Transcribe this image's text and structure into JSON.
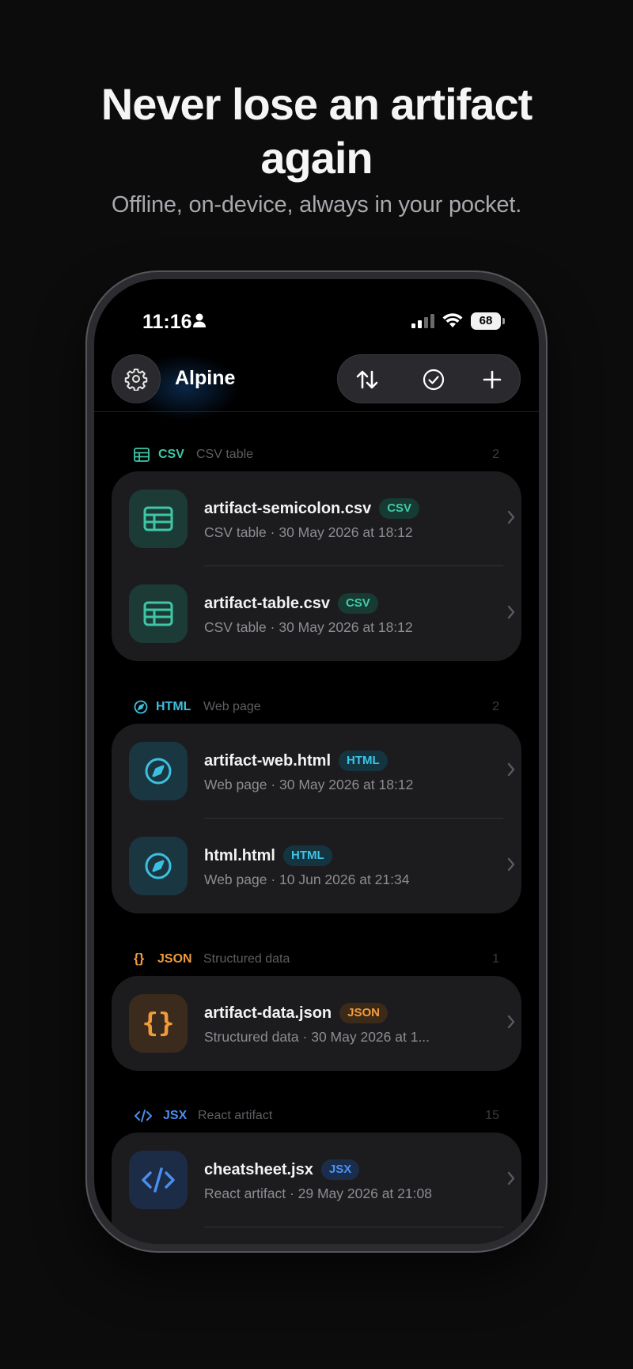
{
  "hero": {
    "title_line1": "Never lose an artifact",
    "title_line2": "again",
    "subtitle": "Offline, on-device, always in your pocket."
  },
  "status_bar": {
    "time": "11:16",
    "battery": "68",
    "icons": [
      "person-icon",
      "signal-icon",
      "wifi-icon",
      "battery-icon"
    ]
  },
  "nav": {
    "app_name": "Alpine",
    "icons": [
      "gear-icon",
      "sort-icon",
      "select-check-icon",
      "plus-icon"
    ]
  },
  "colors": {
    "csv": "#3fc6a7",
    "html": "#3cbfe0",
    "json": "#f09a3c",
    "jsx": "#4a8fef",
    "background": "#0c0c0d",
    "card": "#1c1c1f"
  },
  "sections": [
    {
      "type": "CSV",
      "description": "CSV table",
      "count": "2",
      "icon": "table-icon",
      "items": [
        {
          "title": "artifact-semicolon.csv",
          "badge": "CSV",
          "subtitle": "CSV table · 30 May 2026 at 18:12"
        },
        {
          "title": "artifact-table.csv",
          "badge": "CSV",
          "subtitle": "CSV table · 30 May 2026 at 18:12"
        }
      ]
    },
    {
      "type": "HTML",
      "description": "Web page",
      "count": "2",
      "icon": "compass-icon",
      "items": [
        {
          "title": "artifact-web.html",
          "badge": "HTML",
          "subtitle": "Web page · 30 May 2026 at 18:12"
        },
        {
          "title": "html.html",
          "badge": "HTML",
          "subtitle": "Web page · 10 Jun 2026 at 21:34"
        }
      ]
    },
    {
      "type": "JSON",
      "description": "Structured data",
      "count": "1",
      "icon": "braces-icon",
      "items": [
        {
          "title": "artifact-data.json",
          "badge": "JSON",
          "subtitle": "Structured data · 30 May 2026 at 1..."
        }
      ]
    },
    {
      "type": "JSX",
      "description": "React artifact",
      "count": "15",
      "icon": "code-icon",
      "items": [
        {
          "title": "cheatsheet.jsx",
          "badge": "JSX",
          "subtitle": "React artifact · 29 May 2026 at 21:08"
        }
      ]
    }
  ]
}
